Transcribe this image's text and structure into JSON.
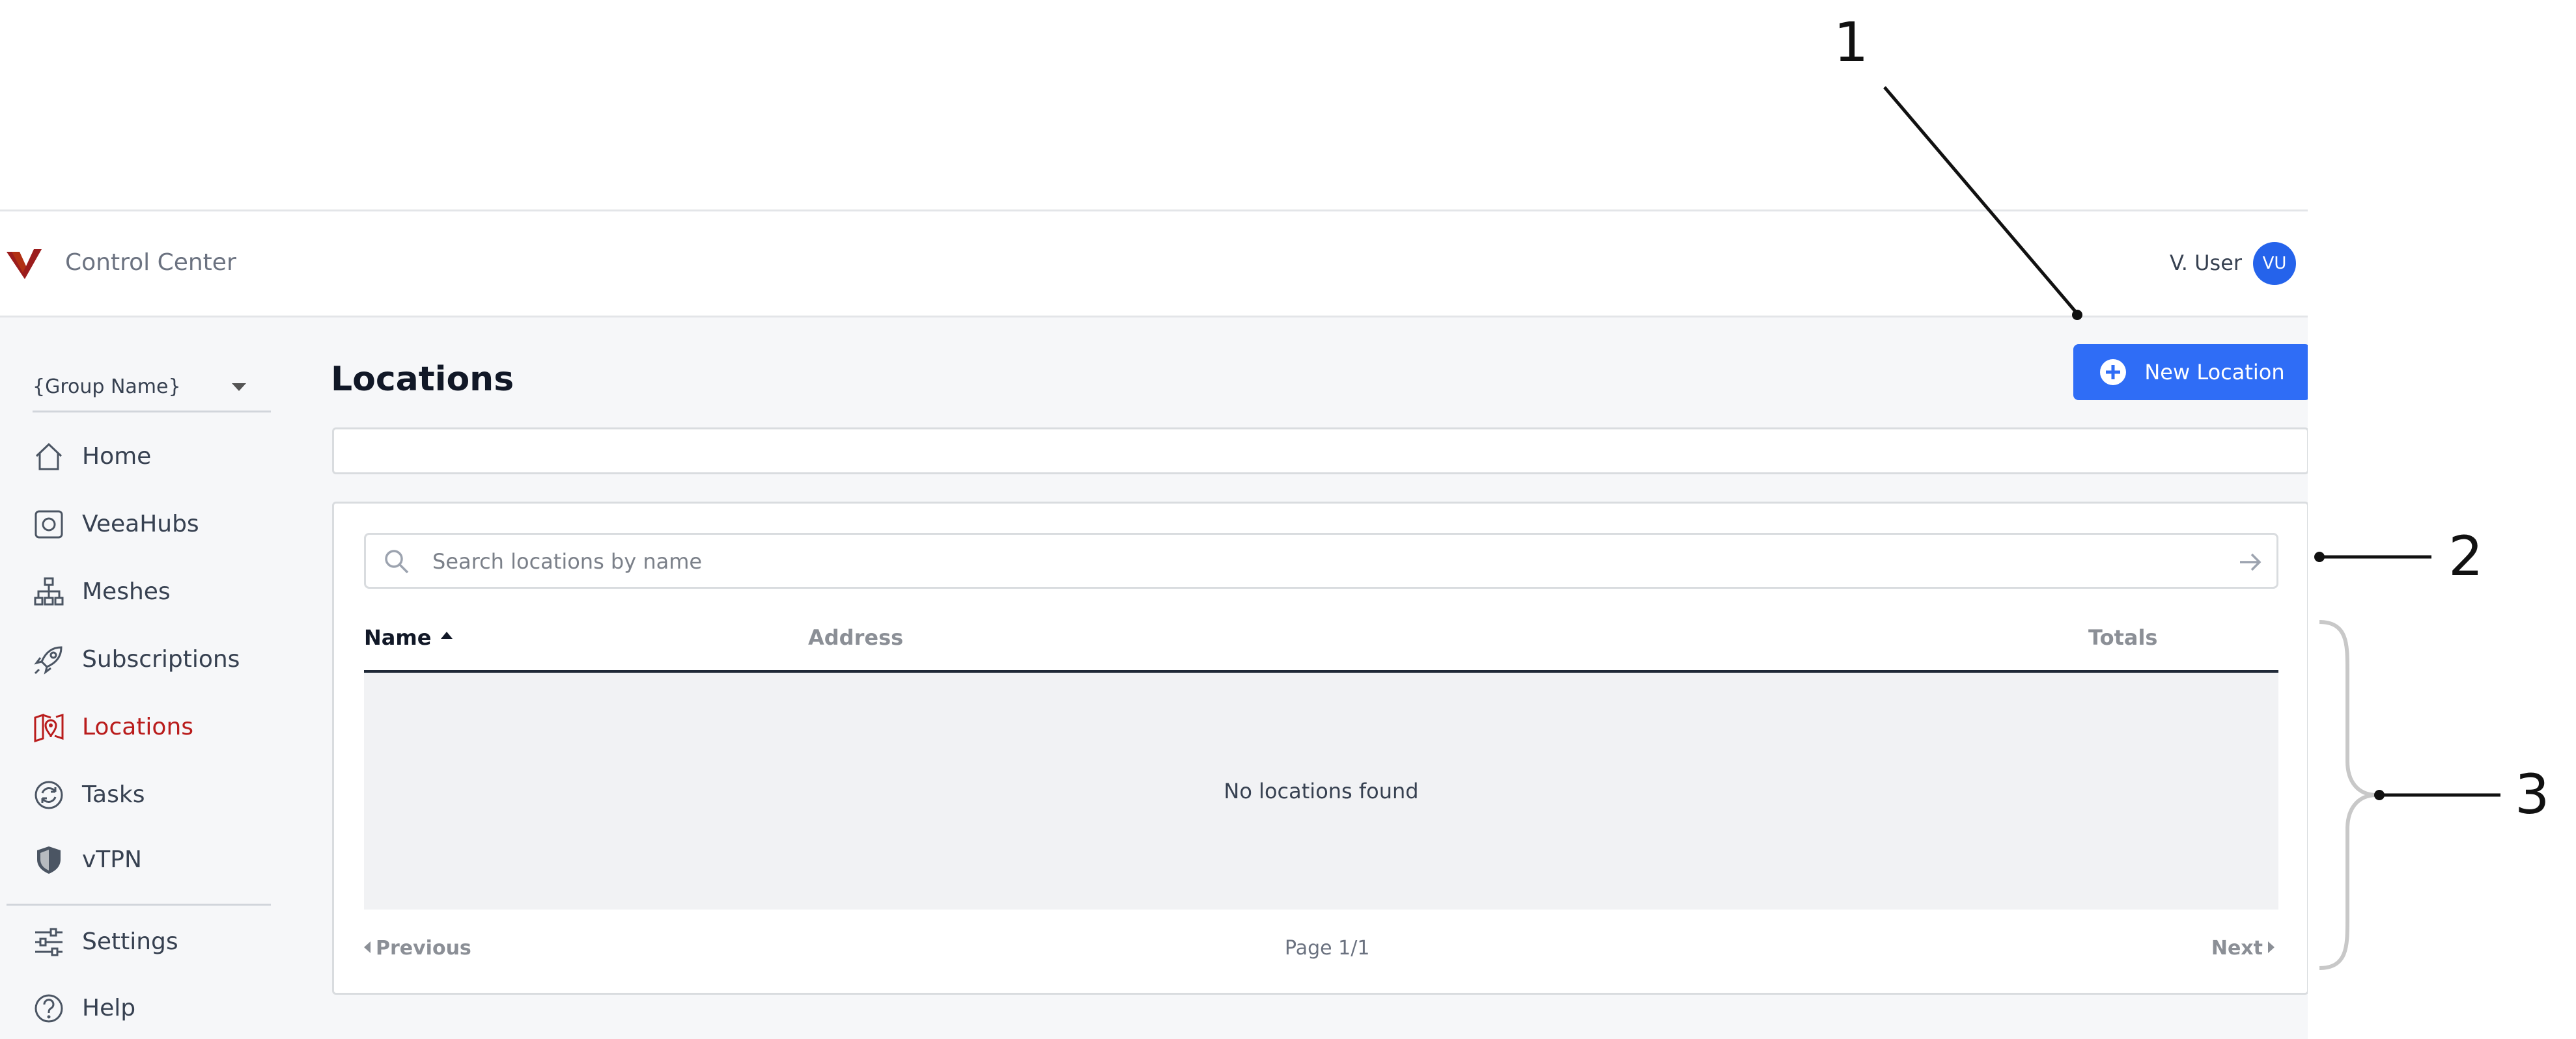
{
  "app": {
    "title": "Control Center"
  },
  "user": {
    "name": "V. User",
    "initials": "VU"
  },
  "sidebar": {
    "group": "{Group Name}",
    "items": [
      {
        "label": "Home",
        "icon": "home-icon"
      },
      {
        "label": "VeeaHubs",
        "icon": "veeahub-icon"
      },
      {
        "label": "Meshes",
        "icon": "mesh-icon"
      },
      {
        "label": "Subscriptions",
        "icon": "rocket-icon"
      },
      {
        "label": "Locations",
        "icon": "map-pin-icon",
        "active": true
      },
      {
        "label": "Tasks",
        "icon": "sync-icon"
      },
      {
        "label": "vTPN",
        "icon": "shield-icon"
      }
    ],
    "footer_items": [
      {
        "label": "Settings",
        "icon": "sliders-icon"
      },
      {
        "label": "Help",
        "icon": "help-icon"
      }
    ]
  },
  "main": {
    "title": "Locations",
    "new_button": "New Location",
    "search": {
      "placeholder": "Search locations by name",
      "value": ""
    },
    "table": {
      "columns": [
        "Name",
        "Address",
        "Totals"
      ],
      "sort": {
        "column": "Name",
        "direction": "ascending"
      },
      "empty_message": "No locations found"
    },
    "pagination": {
      "previous": "Previous",
      "page": "Page 1/1",
      "next": "Next"
    }
  },
  "annotations": {
    "callouts": [
      "1",
      "2",
      "3"
    ]
  },
  "colors": {
    "accent": "#2f6df6",
    "active_nav": "#b91c1c",
    "brand_logo": "#9b1c1c",
    "background": "#f6f7f9"
  }
}
